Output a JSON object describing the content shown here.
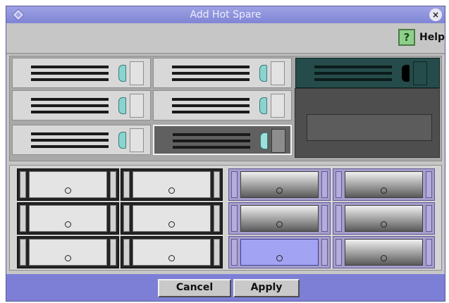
{
  "window": {
    "title": "Add Hot Spare",
    "close_glyph": "×",
    "title_icon": "diamond-logo-icon"
  },
  "help": {
    "icon_glyph": "?",
    "label": "Help"
  },
  "buttons": {
    "cancel": "Cancel",
    "apply": "Apply"
  },
  "colors": {
    "title_bar": "#8085d4",
    "footer_bar": "#7d7fd6",
    "dialog_bg": "#c6c6c6",
    "selected_drive": "#a3a3f4",
    "hot_spare_drive": "#254c4a"
  }
}
